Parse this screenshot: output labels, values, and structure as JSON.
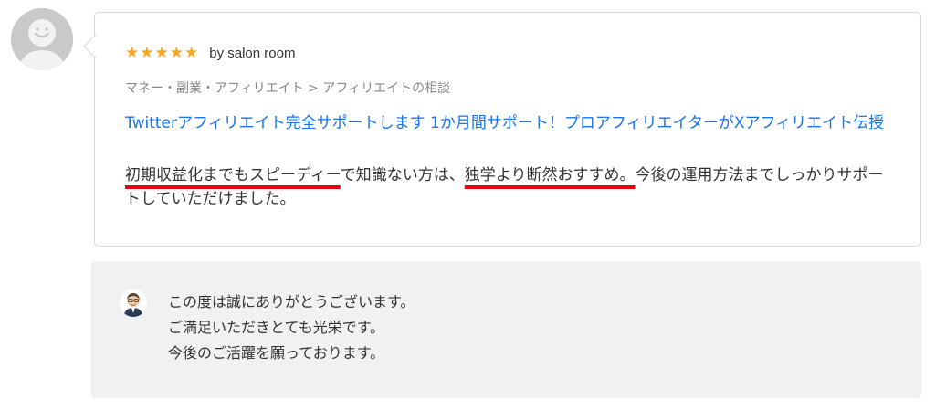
{
  "review": {
    "stars": [
      "★",
      "★",
      "★",
      "★",
      "★"
    ],
    "reviewer": "by salon room",
    "category": "マネー・副業・アフィリエイト > アフィリエイトの相談",
    "service_title": "Twitterアフィリエイト完全サポートします 1か月間サポート！プロアフィリエイターがXアフィリエイト伝授",
    "body": {
      "part1_highlight": "初期収益化までもスピーディー",
      "part2": "で知識ない方は、",
      "part3_highlight": "独学より断然おすすめ。",
      "part4": "今後の運用方法までしっかりサポートしていただけました。"
    }
  },
  "reply": {
    "lines": [
      "この度は誠にありがとうございます。",
      "ご満足いただきとても光栄です。",
      "今後のご活躍を願っております。"
    ]
  },
  "colors": {
    "star": "#f6a623",
    "link": "#1a73e8",
    "highlight_underline": "#e60012",
    "reply_bg": "#f0f1f2"
  },
  "icons": {
    "reviewer_avatar": "default-user-icon",
    "seller_avatar": "seller-portrait-icon"
  }
}
